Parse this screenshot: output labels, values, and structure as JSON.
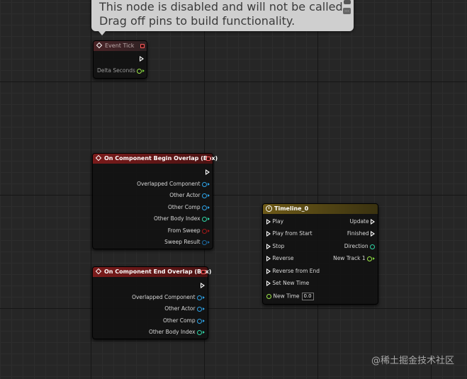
{
  "tooltip": {
    "line1": "This node is disabled and will not be called.",
    "line2": "Drag off pins to build functionality."
  },
  "event_tick": {
    "title": "Event Tick",
    "delta_seconds": "Delta Seconds"
  },
  "begin_overlap": {
    "title": "On Component Begin Overlap (Box)",
    "pins": [
      "Overlapped Component",
      "Other Actor",
      "Other Comp",
      "Other Body Index",
      "From Sweep",
      "Sweep Result"
    ]
  },
  "end_overlap": {
    "title": "On Component End Overlap (Box)",
    "pins": [
      "Overlapped Component",
      "Other Actor",
      "Other Comp",
      "Other Body Index"
    ]
  },
  "timeline": {
    "title": "Timeline_0",
    "inputs": [
      "Play",
      "Play from Start",
      "Stop",
      "Reverse",
      "Reverse from End",
      "Set New Time",
      "New Time"
    ],
    "new_time_value": "0.0",
    "outputs": [
      "Update",
      "Finished",
      "Direction",
      "New Track 1"
    ]
  },
  "watermark": "@稀土掘金技术社区",
  "colors": {
    "event_header": "#7a1b1b",
    "timeline_header": "#6e5a18",
    "object_pin": "#2ea3e8",
    "float_pin": "#7cd43a",
    "int_pin": "#30d6a6",
    "bool_pin": "#a01818"
  }
}
